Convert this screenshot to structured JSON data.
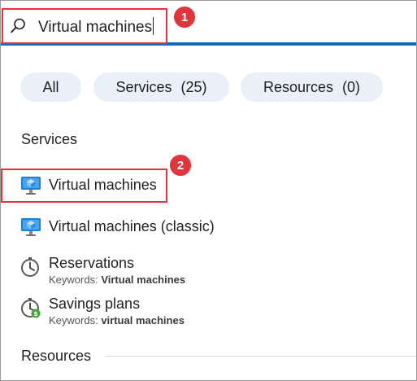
{
  "search": {
    "value": "Virtual machines",
    "icon": "search-icon",
    "accent_color": "#0f6cbd"
  },
  "callouts": [
    {
      "label": "1",
      "color": "#e3343c"
    },
    {
      "label": "2",
      "color": "#e3343c"
    }
  ],
  "filters": [
    {
      "label": "All",
      "count": ""
    },
    {
      "label": "Services",
      "count": "(25)"
    },
    {
      "label": "Resources",
      "count": "(0)"
    }
  ],
  "sections": {
    "services": "Services",
    "resources": "Resources"
  },
  "results": [
    {
      "title": "Virtual machines",
      "icon": "virtual-machine-icon"
    },
    {
      "title": "Virtual machines (classic)",
      "icon": "virtual-machine-classic-icon"
    },
    {
      "title": "Reservations",
      "icon": "reservations-clock-icon",
      "keywords_label": "Keywords:",
      "keywords_value": "Virtual machines"
    },
    {
      "title": "Savings plans",
      "icon": "savings-plans-icon",
      "keywords_label": "Keywords:",
      "keywords_value": "virtual machines"
    }
  ]
}
